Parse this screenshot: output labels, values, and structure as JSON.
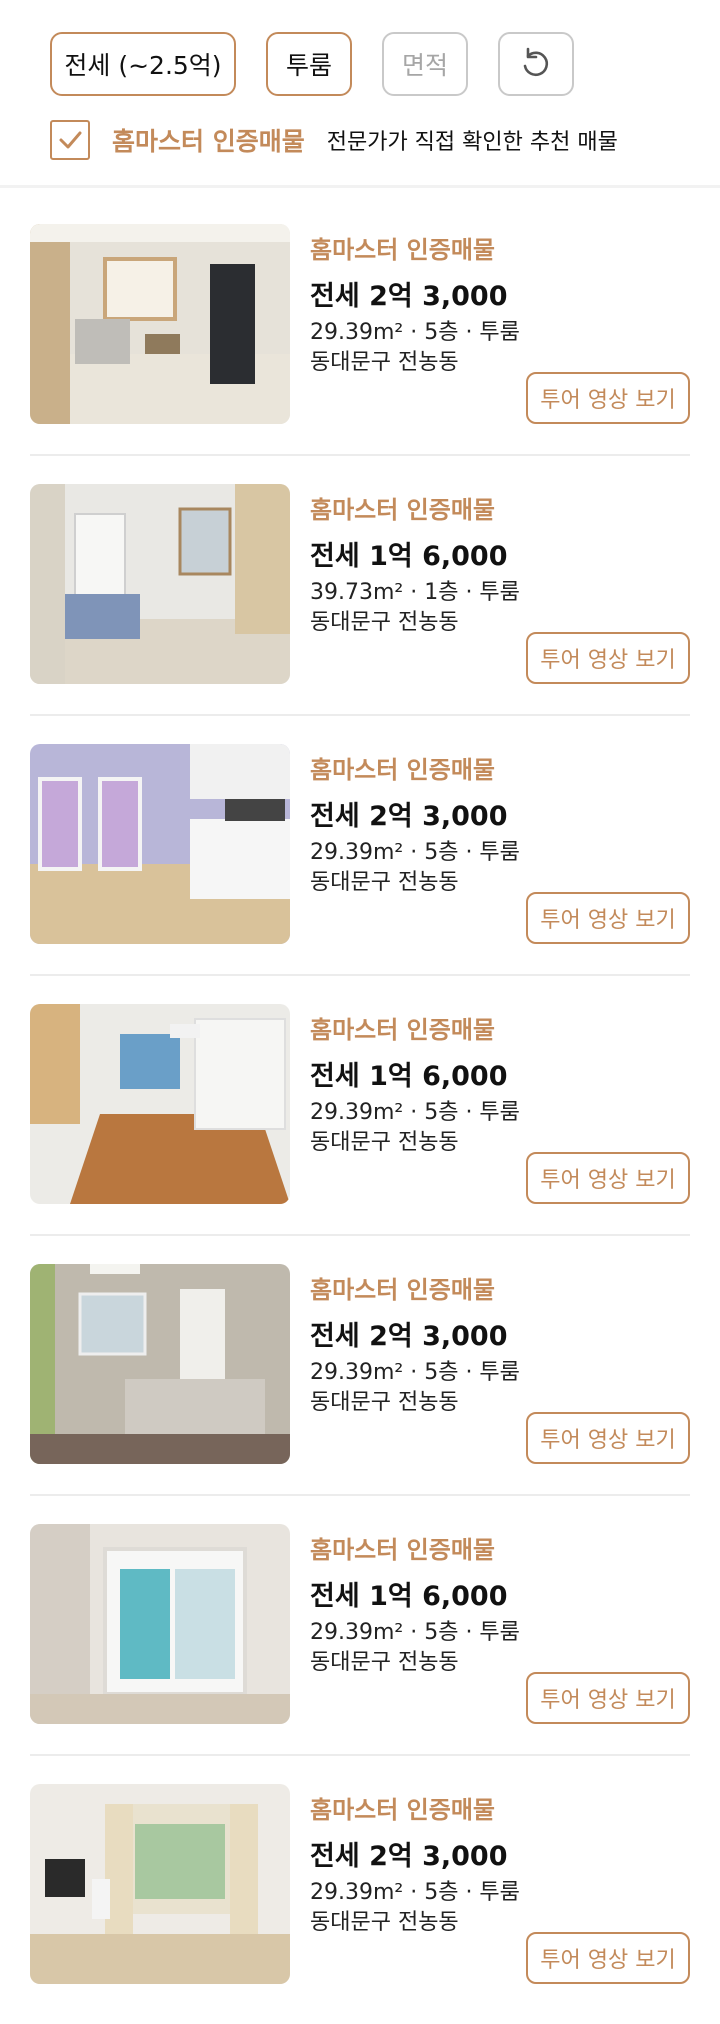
{
  "filters": {
    "deposit_label": "전세 (~2.5억)",
    "room_label": "투룸",
    "area_label": "면적",
    "reset_icon": "refresh-icon"
  },
  "certified": {
    "title": "홈마스터 인증매물",
    "description": "전문가가 직접 확인한 추천 매물",
    "checked": true
  },
  "colors": {
    "accent": "#c38a5a",
    "inactive": "#c9c9c9"
  },
  "listings": [
    {
      "badge": "홈마스터 인증매물",
      "price": "전세 2억 3,000",
      "spec": "29.39m² · 5층 · 투룸",
      "location": "동대문구 전농동",
      "tour_label": "투어 영상 보기"
    },
    {
      "badge": "홈마스터 인증매물",
      "price": "전세 1억 6,000",
      "spec": "39.73m² · 1층 · 투룸",
      "location": "동대문구 전농동",
      "tour_label": "투어 영상 보기"
    },
    {
      "badge": "홈마스터 인증매물",
      "price": "전세 2억 3,000",
      "spec": "29.39m² · 5층 · 투룸",
      "location": "동대문구 전농동",
      "tour_label": "투어 영상 보기"
    },
    {
      "badge": "홈마스터 인증매물",
      "price": "전세 1억 6,000",
      "spec": "29.39m² · 5층 · 투룸",
      "location": "동대문구 전농동",
      "tour_label": "투어 영상 보기"
    },
    {
      "badge": "홈마스터 인증매물",
      "price": "전세 2억 3,000",
      "spec": "29.39m² · 5층 · 투룸",
      "location": "동대문구 전농동",
      "tour_label": "투어 영상 보기"
    },
    {
      "badge": "홈마스터 인증매물",
      "price": "전세 1억 6,000",
      "spec": "29.39m² · 5층 · 투룸",
      "location": "동대문구 전농동",
      "tour_label": "투어 영상 보기"
    },
    {
      "badge": "홈마스터 인증매물",
      "price": "전세 2억 3,000",
      "spec": "29.39m² · 5층 · 투룸",
      "location": "동대문구 전농동",
      "tour_label": "투어 영상 보기"
    }
  ]
}
